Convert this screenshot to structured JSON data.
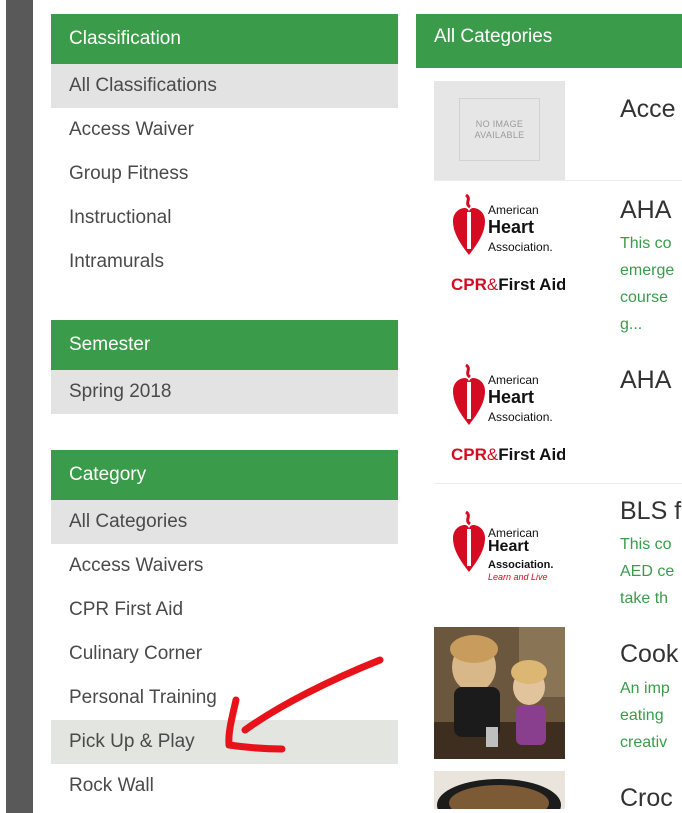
{
  "classification": {
    "header": "Classification",
    "items": [
      "All Classifications",
      "Access Waiver",
      "Group Fitness",
      "Instructional",
      "Intramurals"
    ]
  },
  "semester": {
    "header": "Semester",
    "items": [
      "Spring 2018"
    ]
  },
  "category": {
    "header": "Category",
    "items": [
      "All Categories",
      "Access Waivers",
      "CPR First Aid",
      "Culinary Corner",
      "Personal Training",
      "Pick Up & Play",
      "Rock Wall"
    ]
  },
  "main": {
    "header": "All Categories",
    "no_image": [
      "NO IMAGE",
      "AVAILABLE"
    ],
    "aha_logo": {
      "line1": "American",
      "line2": "Heart",
      "line3": "Association.",
      "cpr": "CPR",
      "amp": "&",
      "first_aid": "First Aid",
      "tagline": "Learn and Live"
    },
    "items": [
      {
        "title": "Acce",
        "desc": []
      },
      {
        "title": "AHA",
        "desc": [
          "This co",
          "emerge",
          "course",
          "g..."
        ]
      },
      {
        "title": "AHA",
        "desc": []
      },
      {
        "title": "BLS f",
        "desc": [
          "This co",
          "AED ce",
          "take th"
        ]
      },
      {
        "title": "Cook",
        "desc": [
          "An imp",
          "eating",
          "creativ"
        ]
      },
      {
        "title": "Croc",
        "desc": []
      }
    ]
  },
  "colors": {
    "accent": "#3a9b4a",
    "selected_bg": "#e3e3e3",
    "annotation_arrow": "#e8121b"
  },
  "icons": [
    "heart-torch-logo-icon",
    "red-arrow-annotation"
  ]
}
